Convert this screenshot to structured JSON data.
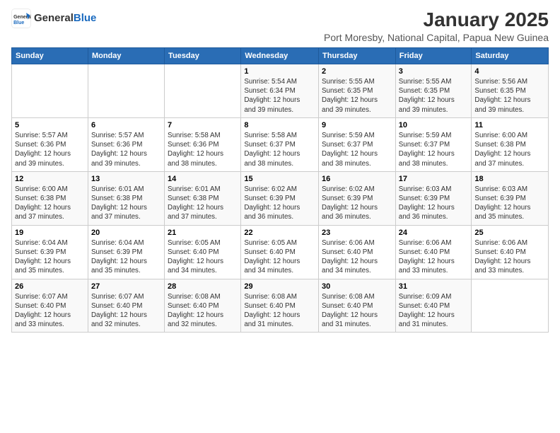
{
  "header": {
    "logo_general": "General",
    "logo_blue": "Blue",
    "month_year": "January 2025",
    "subtitle": "Port Moresby, National Capital, Papua New Guinea"
  },
  "calendar": {
    "days_of_week": [
      "Sunday",
      "Monday",
      "Tuesday",
      "Wednesday",
      "Thursday",
      "Friday",
      "Saturday"
    ],
    "weeks": [
      [
        {
          "day": "",
          "info": ""
        },
        {
          "day": "",
          "info": ""
        },
        {
          "day": "",
          "info": ""
        },
        {
          "day": "1",
          "info": "Sunrise: 5:54 AM\nSunset: 6:34 PM\nDaylight: 12 hours\nand 39 minutes."
        },
        {
          "day": "2",
          "info": "Sunrise: 5:55 AM\nSunset: 6:35 PM\nDaylight: 12 hours\nand 39 minutes."
        },
        {
          "day": "3",
          "info": "Sunrise: 5:55 AM\nSunset: 6:35 PM\nDaylight: 12 hours\nand 39 minutes."
        },
        {
          "day": "4",
          "info": "Sunrise: 5:56 AM\nSunset: 6:35 PM\nDaylight: 12 hours\nand 39 minutes."
        }
      ],
      [
        {
          "day": "5",
          "info": "Sunrise: 5:57 AM\nSunset: 6:36 PM\nDaylight: 12 hours\nand 39 minutes."
        },
        {
          "day": "6",
          "info": "Sunrise: 5:57 AM\nSunset: 6:36 PM\nDaylight: 12 hours\nand 39 minutes."
        },
        {
          "day": "7",
          "info": "Sunrise: 5:58 AM\nSunset: 6:36 PM\nDaylight: 12 hours\nand 38 minutes."
        },
        {
          "day": "8",
          "info": "Sunrise: 5:58 AM\nSunset: 6:37 PM\nDaylight: 12 hours\nand 38 minutes."
        },
        {
          "day": "9",
          "info": "Sunrise: 5:59 AM\nSunset: 6:37 PM\nDaylight: 12 hours\nand 38 minutes."
        },
        {
          "day": "10",
          "info": "Sunrise: 5:59 AM\nSunset: 6:37 PM\nDaylight: 12 hours\nand 38 minutes."
        },
        {
          "day": "11",
          "info": "Sunrise: 6:00 AM\nSunset: 6:38 PM\nDaylight: 12 hours\nand 37 minutes."
        }
      ],
      [
        {
          "day": "12",
          "info": "Sunrise: 6:00 AM\nSunset: 6:38 PM\nDaylight: 12 hours\nand 37 minutes."
        },
        {
          "day": "13",
          "info": "Sunrise: 6:01 AM\nSunset: 6:38 PM\nDaylight: 12 hours\nand 37 minutes."
        },
        {
          "day": "14",
          "info": "Sunrise: 6:01 AM\nSunset: 6:38 PM\nDaylight: 12 hours\nand 37 minutes."
        },
        {
          "day": "15",
          "info": "Sunrise: 6:02 AM\nSunset: 6:39 PM\nDaylight: 12 hours\nand 36 minutes."
        },
        {
          "day": "16",
          "info": "Sunrise: 6:02 AM\nSunset: 6:39 PM\nDaylight: 12 hours\nand 36 minutes."
        },
        {
          "day": "17",
          "info": "Sunrise: 6:03 AM\nSunset: 6:39 PM\nDaylight: 12 hours\nand 36 minutes."
        },
        {
          "day": "18",
          "info": "Sunrise: 6:03 AM\nSunset: 6:39 PM\nDaylight: 12 hours\nand 35 minutes."
        }
      ],
      [
        {
          "day": "19",
          "info": "Sunrise: 6:04 AM\nSunset: 6:39 PM\nDaylight: 12 hours\nand 35 minutes."
        },
        {
          "day": "20",
          "info": "Sunrise: 6:04 AM\nSunset: 6:39 PM\nDaylight: 12 hours\nand 35 minutes."
        },
        {
          "day": "21",
          "info": "Sunrise: 6:05 AM\nSunset: 6:40 PM\nDaylight: 12 hours\nand 34 minutes."
        },
        {
          "day": "22",
          "info": "Sunrise: 6:05 AM\nSunset: 6:40 PM\nDaylight: 12 hours\nand 34 minutes."
        },
        {
          "day": "23",
          "info": "Sunrise: 6:06 AM\nSunset: 6:40 PM\nDaylight: 12 hours\nand 34 minutes."
        },
        {
          "day": "24",
          "info": "Sunrise: 6:06 AM\nSunset: 6:40 PM\nDaylight: 12 hours\nand 33 minutes."
        },
        {
          "day": "25",
          "info": "Sunrise: 6:06 AM\nSunset: 6:40 PM\nDaylight: 12 hours\nand 33 minutes."
        }
      ],
      [
        {
          "day": "26",
          "info": "Sunrise: 6:07 AM\nSunset: 6:40 PM\nDaylight: 12 hours\nand 33 minutes."
        },
        {
          "day": "27",
          "info": "Sunrise: 6:07 AM\nSunset: 6:40 PM\nDaylight: 12 hours\nand 32 minutes."
        },
        {
          "day": "28",
          "info": "Sunrise: 6:08 AM\nSunset: 6:40 PM\nDaylight: 12 hours\nand 32 minutes."
        },
        {
          "day": "29",
          "info": "Sunrise: 6:08 AM\nSunset: 6:40 PM\nDaylight: 12 hours\nand 31 minutes."
        },
        {
          "day": "30",
          "info": "Sunrise: 6:08 AM\nSunset: 6:40 PM\nDaylight: 12 hours\nand 31 minutes."
        },
        {
          "day": "31",
          "info": "Sunrise: 6:09 AM\nSunset: 6:40 PM\nDaylight: 12 hours\nand 31 minutes."
        },
        {
          "day": "",
          "info": ""
        }
      ]
    ]
  }
}
